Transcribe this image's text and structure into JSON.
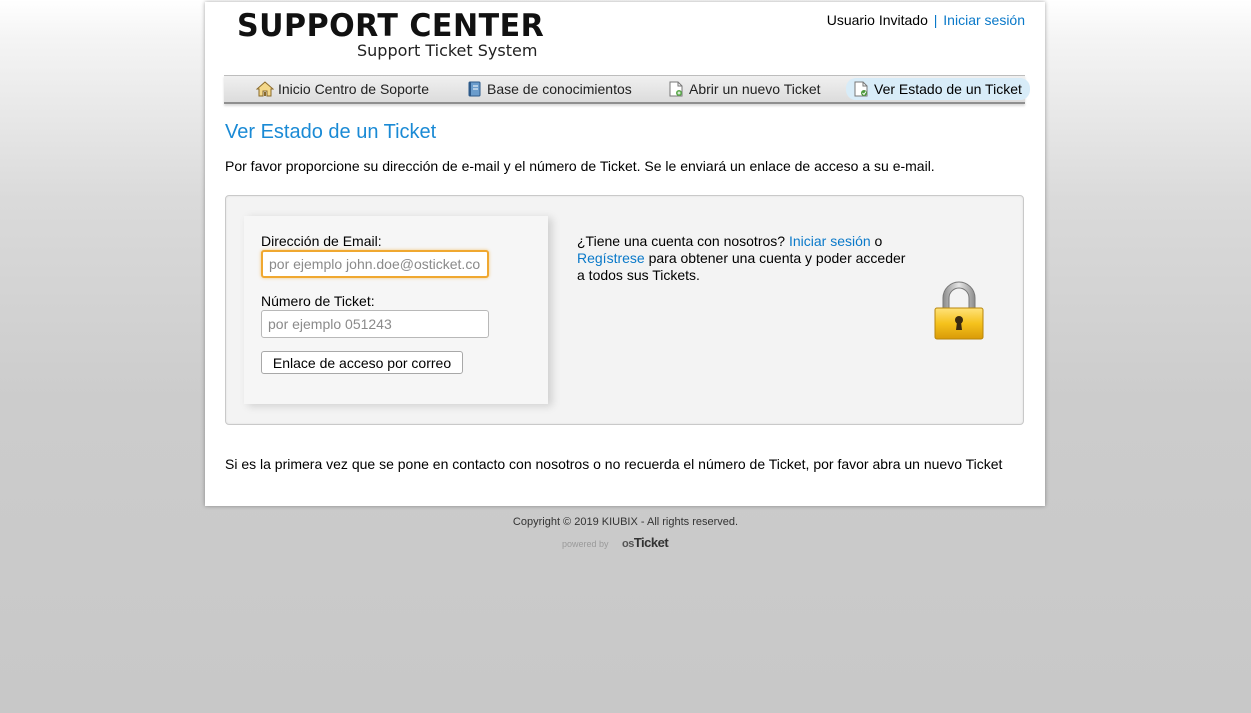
{
  "header": {
    "logo_title": "SUPPORT CENTER",
    "logo_subtitle": "Support Ticket System",
    "user_label": "Usuario Invitado",
    "separator": "|",
    "login_link": "Iniciar sesión"
  },
  "nav": {
    "items": [
      {
        "label": "Inicio Centro de Soporte",
        "icon": "home-icon"
      },
      {
        "label": "Base de conocimientos",
        "icon": "book-icon"
      },
      {
        "label": "Abrir un nuevo Ticket",
        "icon": "new-ticket-icon"
      },
      {
        "label": "Ver Estado de un Ticket",
        "icon": "ticket-status-icon",
        "active": true
      }
    ]
  },
  "main": {
    "title": "Ver Estado de un Ticket",
    "intro": "Por favor proporcione su dirección de e-mail y el número de Ticket. Se le enviará un enlace de acceso a su e-mail.",
    "form": {
      "email_label": "Dirección de Email:",
      "email_placeholder": "por ejemplo john.doe@osticket.com",
      "email_value": "",
      "ticket_label": "Número de Ticket:",
      "ticket_placeholder": "por ejemplo 051243",
      "ticket_value": "",
      "submit_label": "Enlace de acceso por correo"
    },
    "account": {
      "text_before": "¿Tiene una cuenta con nosotros? ",
      "login_link": "Iniciar sesión",
      "text_or": " o ",
      "register_link": "Regístrese",
      "text_after": " para obtener una cuenta y poder acceder a todos sus Tickets."
    },
    "lock_icon": "padlock-icon",
    "footer_note": "Si es la primera vez que se pone en contacto con nosotros o no recuerda el número de Ticket, por favor abra un nuevo Ticket"
  },
  "footer": {
    "copyright": "Copyright © 2019 KIUBIX - All rights reserved.",
    "powered_by": "powered by",
    "brand_os": "os",
    "brand_name": "Ticket"
  },
  "colors": {
    "link": "#0a79c9",
    "title": "#1a8ad5",
    "focus_border": "#f0a830",
    "nav_active": "#d8ecf8"
  }
}
